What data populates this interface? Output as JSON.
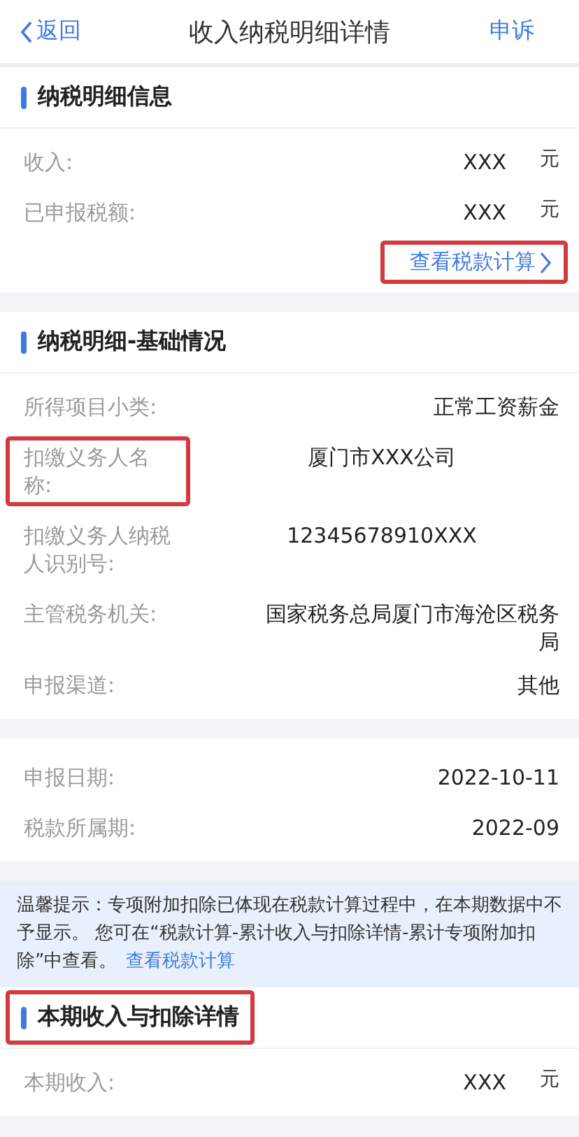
{
  "nav": {
    "back": "返回",
    "title": "收入纳税明细详情",
    "action": "申诉"
  },
  "sections": [
    {
      "title": "纳税明细信息",
      "title_highlighted": false,
      "rows": [
        {
          "label": "收入:",
          "value": "XXX",
          "unit": "元",
          "label_highlighted": false
        },
        {
          "label": "已申报税额:",
          "value": "XXX",
          "unit": "元",
          "label_highlighted": false
        }
      ],
      "link": {
        "text": "查看税款计算",
        "highlighted": true
      }
    },
    {
      "title": "纳税明细-基础情况",
      "title_highlighted": false,
      "rows": [
        {
          "label": "所得项目小类:",
          "value": "正常工资薪金",
          "kind": "right",
          "label_highlighted": false
        },
        {
          "label": "扣缴义务人名称:",
          "value": "厦门市XXX公司",
          "kind": "center",
          "label_highlighted": true
        },
        {
          "label": "扣缴义务人纳税人识别号:",
          "value": "12345678910XXX",
          "kind": "center",
          "label_highlighted": false
        },
        {
          "label": "主管税务机关:",
          "value": "国家税务总局厦门市海沧区税务局",
          "kind": "right",
          "label_highlighted": false
        },
        {
          "label": "申报渠道:",
          "value": "其他",
          "kind": "right",
          "label_highlighted": false
        }
      ]
    },
    {
      "rows": [
        {
          "label": "申报日期:",
          "value": "2022-10-11",
          "kind": "right",
          "label_highlighted": false
        },
        {
          "label": "税款所属期:",
          "value": "2022-09",
          "kind": "right",
          "label_highlighted": false
        }
      ]
    }
  ],
  "notice": {
    "text": "温馨提示：专项附加扣除已体现在税款计算过程中，在本期数据中不予显示。 您可在“税款计算-累计收入与扣除详情-累计专项附加扣除”中查看。",
    "link": "查看税款计算"
  },
  "bottom_section": {
    "title": "本期收入与扣除详情",
    "title_highlighted": true,
    "rows": [
      {
        "label": "本期收入:",
        "value": "XXX",
        "unit": "元",
        "label_highlighted": false
      }
    ]
  }
}
